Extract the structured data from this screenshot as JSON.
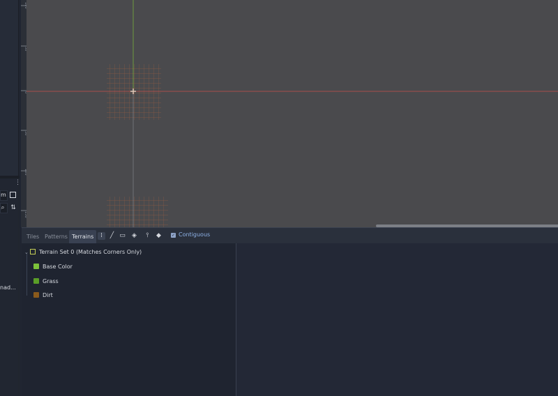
{
  "left_dock": {
    "field_fragment": "m",
    "status_fragment": "nad...",
    "menu_icon": "vertical-dots-icon",
    "window_icon": "window-icon",
    "search_icon": "search-icon",
    "sort_icon": "sort-icon"
  },
  "ruler": {
    "tick_labels": [
      "100",
      "50",
      "0",
      "50",
      "100",
      "150"
    ]
  },
  "tabs": [
    {
      "label": "Tiles",
      "active": false
    },
    {
      "label": "Patterns",
      "active": false
    },
    {
      "label": "Terrains",
      "active": true
    }
  ],
  "toolbar": {
    "tools": [
      "select-icon",
      "line-icon",
      "rectangle-icon",
      "bucket-fill-icon",
      "picker-icon",
      "eraser-icon"
    ],
    "contiguous_label": "Contiguous",
    "contiguous_checked": true
  },
  "terrain_tree": {
    "set": {
      "label": "Terrain Set 0 (Matches Corners Only)"
    },
    "terrains": [
      {
        "label": "Base Color",
        "color": "#7cc23a"
      },
      {
        "label": "Grass",
        "color": "#5a9e27"
      },
      {
        "label": "Dirt",
        "color": "#8a5a1c"
      }
    ]
  },
  "colors": {
    "viewport_bg": "#4a4a4d",
    "axis_x": "#c0504a",
    "axis_y": "#76a83c",
    "grid": "#b8643c",
    "accent": "#8fb3e8"
  }
}
